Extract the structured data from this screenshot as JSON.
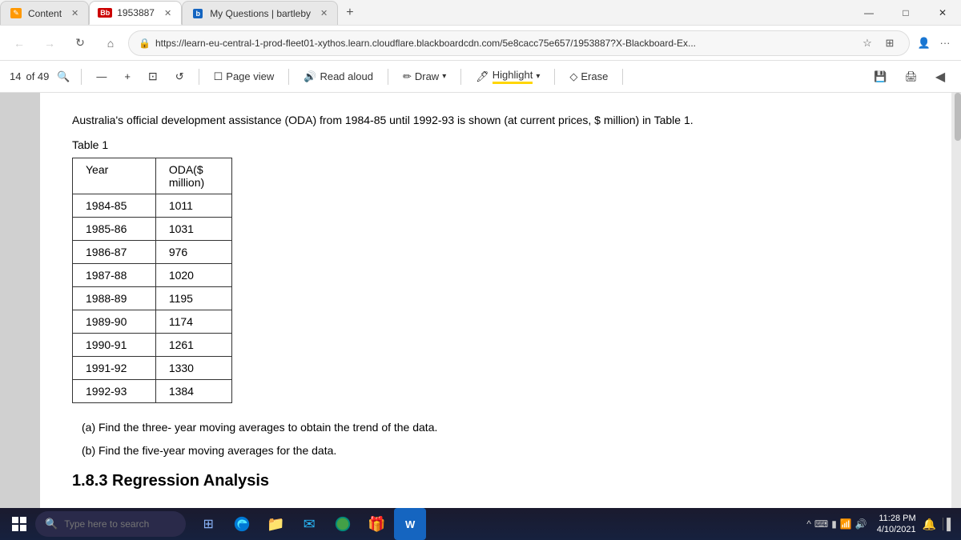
{
  "titlebar": {
    "tabs": [
      {
        "id": "tab-content",
        "label": "Content",
        "icon": "📄",
        "icon_type": "content",
        "active": false,
        "closable": true
      },
      {
        "id": "tab-bb",
        "label": "1953887",
        "icon": "Bb",
        "icon_type": "bb",
        "active": true,
        "closable": true
      },
      {
        "id": "tab-bartleby",
        "label": "My Questions | bartleby",
        "icon": "b",
        "icon_type": "b",
        "active": false,
        "closable": true
      }
    ],
    "new_tab_label": "+",
    "minimize": "—",
    "restore": "□",
    "close": "✕"
  },
  "addressbar": {
    "back": "←",
    "forward": "→",
    "refresh": "↻",
    "home": "⌂",
    "url": "https://learn-eu-central-1-prod-fleet01-xythos.learn.cloudflare.blackboardcdn.com/5e8cacc75e657/1953887?X-Blackboard-Ex...",
    "lock_icon": "🔒",
    "star_icon": "☆",
    "collections_icon": "⊞",
    "profile_icon": "👤",
    "more_icon": "..."
  },
  "toolbar": {
    "page_number": "14",
    "total_pages": "of 49",
    "zoom_out": "—",
    "zoom_in": "+",
    "rotate": "↺",
    "page_view_label": "Page view",
    "read_aloud_label": "Read aloud",
    "draw_label": "Draw",
    "highlight_label": "Highlight",
    "erase_label": "Erase",
    "save_icon": "💾",
    "print_icon": "🖨",
    "pin_icon": "📌"
  },
  "document": {
    "intro_text": "Australia's official development assistance (ODA) from 1984-85 until 1992-93 is shown (at current prices, $ million) in Table 1.",
    "table_title": "Table 1",
    "table_headers": [
      "Year",
      "ODA($ million)"
    ],
    "table_rows": [
      [
        "1984-85",
        "1011"
      ],
      [
        "1985-86",
        "1031"
      ],
      [
        "1986-87",
        "976"
      ],
      [
        "1987-88",
        "1020"
      ],
      [
        "1988-89",
        "1195"
      ],
      [
        "1989-90",
        "1174"
      ],
      [
        "1990-91",
        "1261"
      ],
      [
        "1991-92",
        "1330"
      ],
      [
        "1992-93",
        "1384"
      ]
    ],
    "question_a": "(a) Find the three- year moving averages to obtain the trend of the data.",
    "question_b": "(b) Find the five-year moving averages for the data.",
    "section_heading": "1.8.3 Regression Analysis"
  },
  "taskbar": {
    "search_placeholder": "Type here to search",
    "apps": [
      "⊞",
      "⭕",
      "📁",
      "✉",
      "🌐",
      "🎁",
      "W"
    ],
    "tray": {
      "caret": "^",
      "keyboard": "⌨",
      "battery": "🔋",
      "volume": "🔊",
      "time": "11:28 PM",
      "date": "4/10/2021",
      "notification": "🔔"
    }
  }
}
